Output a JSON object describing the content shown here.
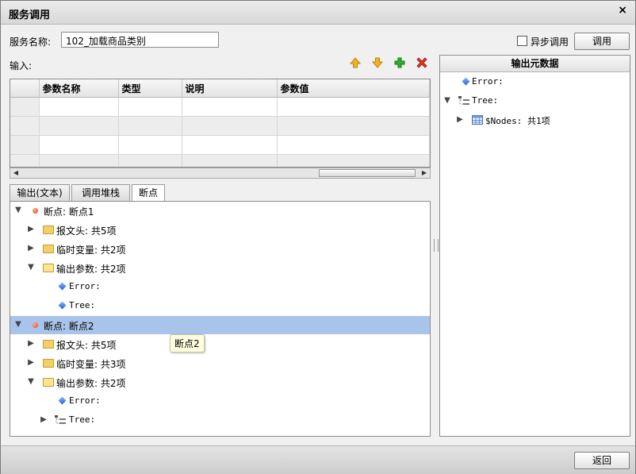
{
  "window": {
    "title": "服务调用",
    "close_glyph": "×"
  },
  "form": {
    "service_name_label": "服务名称:",
    "service_name_value": "102_加载商品类别",
    "async_label": "异步调用",
    "async_checked": false,
    "invoke_label": "调用",
    "input_label": "输入:"
  },
  "toolbar": {
    "up_icon": "arrow-up-icon",
    "down_icon": "arrow-down-icon",
    "add_icon": "plus-icon",
    "delete_icon": "delete-x-icon",
    "colors": {
      "up_down": "#f0b020",
      "add": "#22a020",
      "delete": "#d83020"
    }
  },
  "params_table": {
    "columns": [
      "参数名称",
      "类型",
      "说明",
      "参数值"
    ],
    "rows": [
      [
        "",
        "",
        "",
        ""
      ],
      [
        "",
        "",
        "",
        ""
      ],
      [
        "",
        "",
        "",
        ""
      ],
      [
        "",
        "",
        "",
        ""
      ]
    ]
  },
  "tabs": [
    {
      "label": "输出(文本)",
      "active": false
    },
    {
      "label": "调用堆栈",
      "active": false
    },
    {
      "label": "断点",
      "active": true
    }
  ],
  "breakpoint_tree": [
    {
      "label": "断点: 断点1",
      "icon": "breakpoint-dot-icon",
      "expanded": true,
      "selected": false
    },
    {
      "label": "报文头: 共5项",
      "icon": "folder-icon",
      "expanded": false
    },
    {
      "label": "临时变量: 共2项",
      "icon": "folder-icon",
      "expanded": false
    },
    {
      "label": "输出参数: 共2项",
      "icon": "folder-open-icon",
      "expanded": true
    },
    {
      "label": "Error:",
      "icon": "diamond-icon"
    },
    {
      "label": "Tree:",
      "icon": "diamond-icon"
    },
    {
      "label": "断点: 断点2",
      "icon": "breakpoint-dot-icon",
      "expanded": true,
      "selected": true
    },
    {
      "label": "报文头: 共5项",
      "icon": "folder-icon",
      "expanded": false
    },
    {
      "label": "临时变量: 共3项",
      "icon": "folder-icon",
      "expanded": false
    },
    {
      "label": "输出参数: 共2项",
      "icon": "folder-open-icon",
      "expanded": true
    },
    {
      "label": "Error:",
      "icon": "diamond-icon"
    },
    {
      "label": "Tree:",
      "icon": "tree-structure-icon",
      "expanded": false
    }
  ],
  "tooltip": {
    "text": "断点2"
  },
  "output_metadata": {
    "title": "输出元数据",
    "items": [
      {
        "label": "Error:",
        "icon": "diamond-icon"
      },
      {
        "label": "Tree:",
        "icon": "tree-structure-icon",
        "expanded": true
      },
      {
        "label": "$Nodes: 共1项",
        "icon": "table-icon",
        "expanded": false
      }
    ]
  },
  "footer": {
    "return_label": "返回"
  }
}
